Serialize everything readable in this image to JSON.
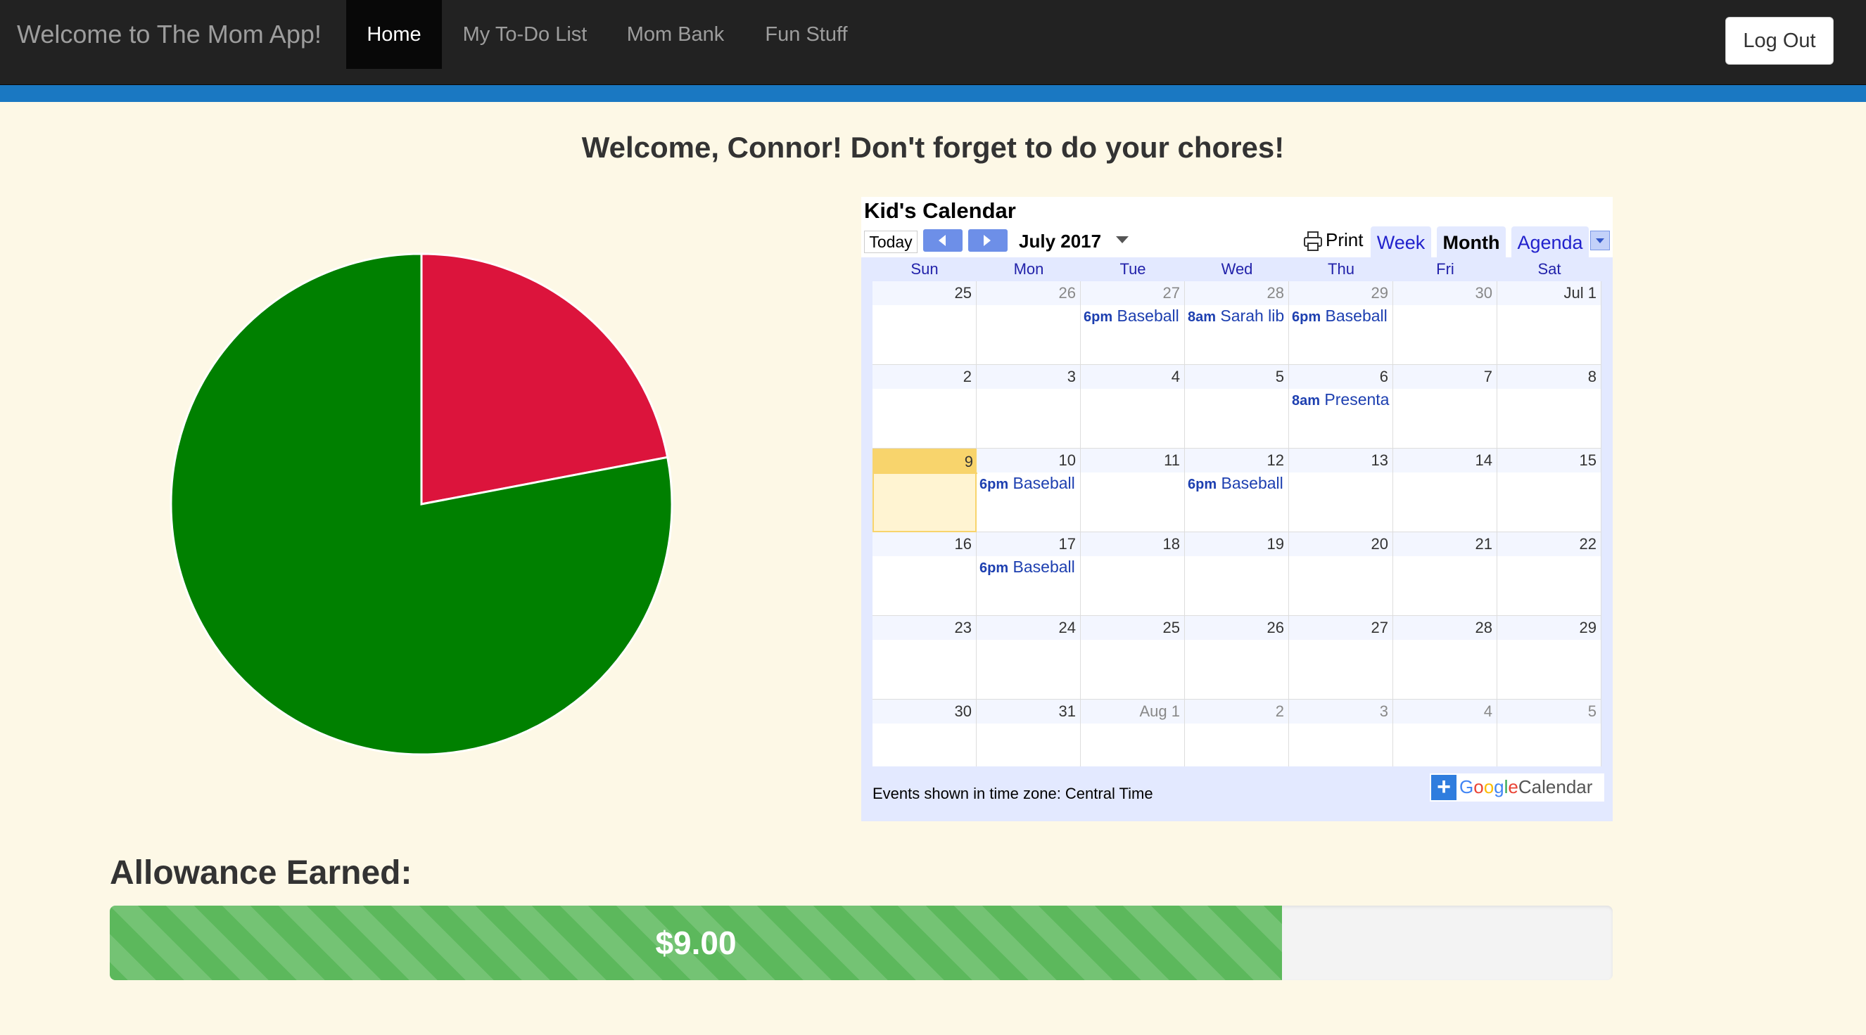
{
  "nav": {
    "brand": "Welcome to The Mom App!",
    "items": [
      {
        "label": "Home",
        "active": true
      },
      {
        "label": "My To-Do List",
        "active": false
      },
      {
        "label": "Mom Bank",
        "active": false
      },
      {
        "label": "Fun Stuff",
        "active": false
      }
    ],
    "logout_label": "Log Out"
  },
  "welcome": "Welcome, Connor! Don't forget to do your chores!",
  "chart_data": {
    "type": "pie",
    "slices": [
      {
        "value": 22,
        "color": "#dc143c"
      },
      {
        "value": 78,
        "color": "#008000"
      }
    ]
  },
  "calendar": {
    "title": "Kid's Calendar",
    "today_label": "Today",
    "month_label": "July 2017",
    "print_label": "Print",
    "views": [
      "Week",
      "Month",
      "Agenda"
    ],
    "selected_view": "Month",
    "days_of_week": [
      "Sun",
      "Mon",
      "Tue",
      "Wed",
      "Thu",
      "Fri",
      "Sat"
    ],
    "weeks": [
      [
        {
          "day": "25",
          "other": false
        },
        {
          "day": "26",
          "other": true
        },
        {
          "day": "27",
          "other": true,
          "event_time": "6pm",
          "event_title": "Baseball"
        },
        {
          "day": "28",
          "other": true,
          "event_time": "8am",
          "event_title": "Sarah lib"
        },
        {
          "day": "29",
          "other": true,
          "event_time": "6pm",
          "event_title": "Baseball"
        },
        {
          "day": "30",
          "other": true
        },
        {
          "day": "Jul 1",
          "other": false
        }
      ],
      [
        {
          "day": "2"
        },
        {
          "day": "3"
        },
        {
          "day": "4"
        },
        {
          "day": "5"
        },
        {
          "day": "6",
          "event_time": "8am",
          "event_title": "Presenta"
        },
        {
          "day": "7"
        },
        {
          "day": "8"
        }
      ],
      [
        {
          "day": "9",
          "today": true
        },
        {
          "day": "10",
          "event_time": "6pm",
          "event_title": "Baseball"
        },
        {
          "day": "11"
        },
        {
          "day": "12",
          "event_time": "6pm",
          "event_title": "Baseball"
        },
        {
          "day": "13"
        },
        {
          "day": "14"
        },
        {
          "day": "15"
        }
      ],
      [
        {
          "day": "16"
        },
        {
          "day": "17",
          "event_time": "6pm",
          "event_title": "Baseball"
        },
        {
          "day": "18"
        },
        {
          "day": "19"
        },
        {
          "day": "20"
        },
        {
          "day": "21"
        },
        {
          "day": "22"
        }
      ],
      [
        {
          "day": "23"
        },
        {
          "day": "24"
        },
        {
          "day": "25"
        },
        {
          "day": "26"
        },
        {
          "day": "27"
        },
        {
          "day": "28"
        },
        {
          "day": "29"
        }
      ],
      [
        {
          "day": "30"
        },
        {
          "day": "31"
        },
        {
          "day": "Aug 1",
          "other": true
        },
        {
          "day": "2",
          "other": true
        },
        {
          "day": "3",
          "other": true
        },
        {
          "day": "4",
          "other": true
        },
        {
          "day": "5",
          "other": true
        }
      ]
    ],
    "timezone_text": "Events shown in time zone: Central Time",
    "google_label": "Google",
    "calendar_word": "Calendar"
  },
  "allowance": {
    "heading": "Allowance Earned:",
    "amount": "$9.00",
    "progress_fraction": 0.78
  },
  "colors": {
    "nav_bg": "#222222",
    "accent_strip": "#1a78c2",
    "page_bg": "#fdf8e6",
    "progress_green": "#5cb85c"
  }
}
